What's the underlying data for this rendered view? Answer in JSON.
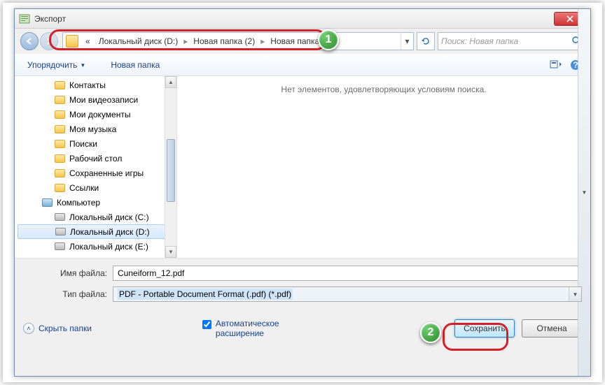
{
  "window": {
    "title": "Экспорт"
  },
  "breadcrumbs": {
    "prefix": "«",
    "items": [
      "Локальный диск (D:)",
      "Новая папка (2)",
      "Новая папка"
    ]
  },
  "search": {
    "placeholder": "Поиск: Новая папка"
  },
  "toolbar": {
    "organize": "Упорядочить",
    "newfolder": "Новая папка"
  },
  "tree": {
    "items": [
      {
        "label": "Контакты",
        "icon": "folder",
        "level": 3
      },
      {
        "label": "Мои видеозаписи",
        "icon": "folder",
        "level": 3
      },
      {
        "label": "Мои документы",
        "icon": "folder",
        "level": 3
      },
      {
        "label": "Моя музыка",
        "icon": "folder",
        "level": 3
      },
      {
        "label": "Поиски",
        "icon": "folder",
        "level": 3
      },
      {
        "label": "Рабочий стол",
        "icon": "folder",
        "level": 3
      },
      {
        "label": "Сохраненные игры",
        "icon": "folder",
        "level": 3
      },
      {
        "label": "Ссылки",
        "icon": "folder",
        "level": 3
      },
      {
        "label": "Компьютер",
        "icon": "pc",
        "level": 2
      },
      {
        "label": "Локальный диск (C:)",
        "icon": "drive",
        "level": 3
      },
      {
        "label": "Локальный диск (D:)",
        "icon": "drive",
        "level": 3,
        "selected": true
      },
      {
        "label": "Локальный диск (E:)",
        "icon": "drive",
        "level": 3
      }
    ]
  },
  "filelist": {
    "empty_msg": "Нет элементов, удовлетворяющих условиям поиска."
  },
  "fields": {
    "filename_label": "Имя файла:",
    "filename_value": "Cuneiform_12.pdf",
    "filetype_label": "Тип файла:",
    "filetype_value": "PDF - Portable Document Format (.pdf) (*.pdf)"
  },
  "footer": {
    "hide_folders": "Скрыть папки",
    "auto_ext": "Автоматическое расширение",
    "save": "Сохранить",
    "cancel": "Отмена"
  },
  "annotations": {
    "b1": "1",
    "b2": "2"
  }
}
